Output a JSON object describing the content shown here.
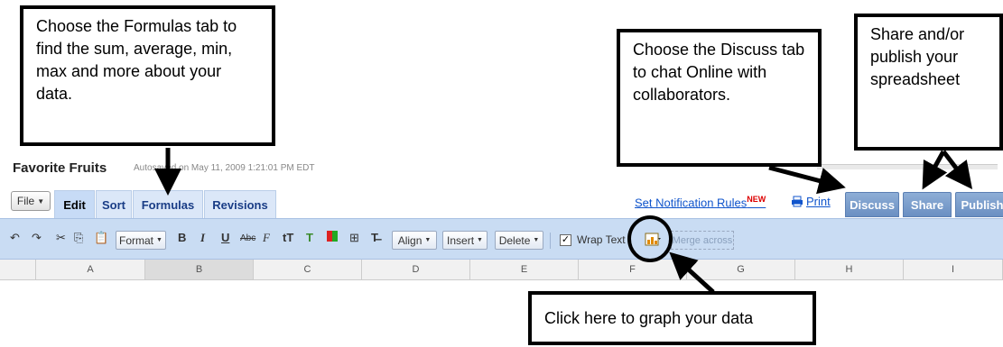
{
  "document": {
    "title": "Favorite Fruits",
    "autosave": "Autosaved on May 11, 2009 1:21:01 PM EDT"
  },
  "tabs": {
    "file": "File",
    "items": [
      "Edit",
      "Sort",
      "Formulas",
      "Revisions"
    ],
    "active": "Edit"
  },
  "header_links": {
    "notification": "Set Notification Rules",
    "notification_badge": "NEW",
    "print": "Print"
  },
  "header_buttons": {
    "discuss": "Discuss",
    "share": "Share",
    "publish": "Publish"
  },
  "toolbar": {
    "format": "Format",
    "bold": "B",
    "italic": "I",
    "underline": "U",
    "strikethrough": "Abc",
    "font_family": "F",
    "font_size": "tT",
    "align": "Align",
    "insert": "Insert",
    "delete": "Delete",
    "wrap_text": "Wrap Text",
    "wrap_checked": "✓",
    "merge_across": "Merge across"
  },
  "columns": [
    "A",
    "B",
    "C",
    "D",
    "E",
    "F",
    "G",
    "H",
    "I"
  ],
  "selected_column": "B",
  "callouts": {
    "formulas": "Choose the Formulas tab to find the sum, average, min, max and more about your data.",
    "discuss": "Choose the Discuss tab to chat Online with collaborators.",
    "share": "Share and/or publish your spreadsheet",
    "graph": "Click here to graph your data"
  },
  "colors": {
    "toolbar_bg": "#c9dcf3",
    "tab_bg": "#dbe7f8",
    "blue_button": "#7b9dcc",
    "link": "#1155cc"
  }
}
